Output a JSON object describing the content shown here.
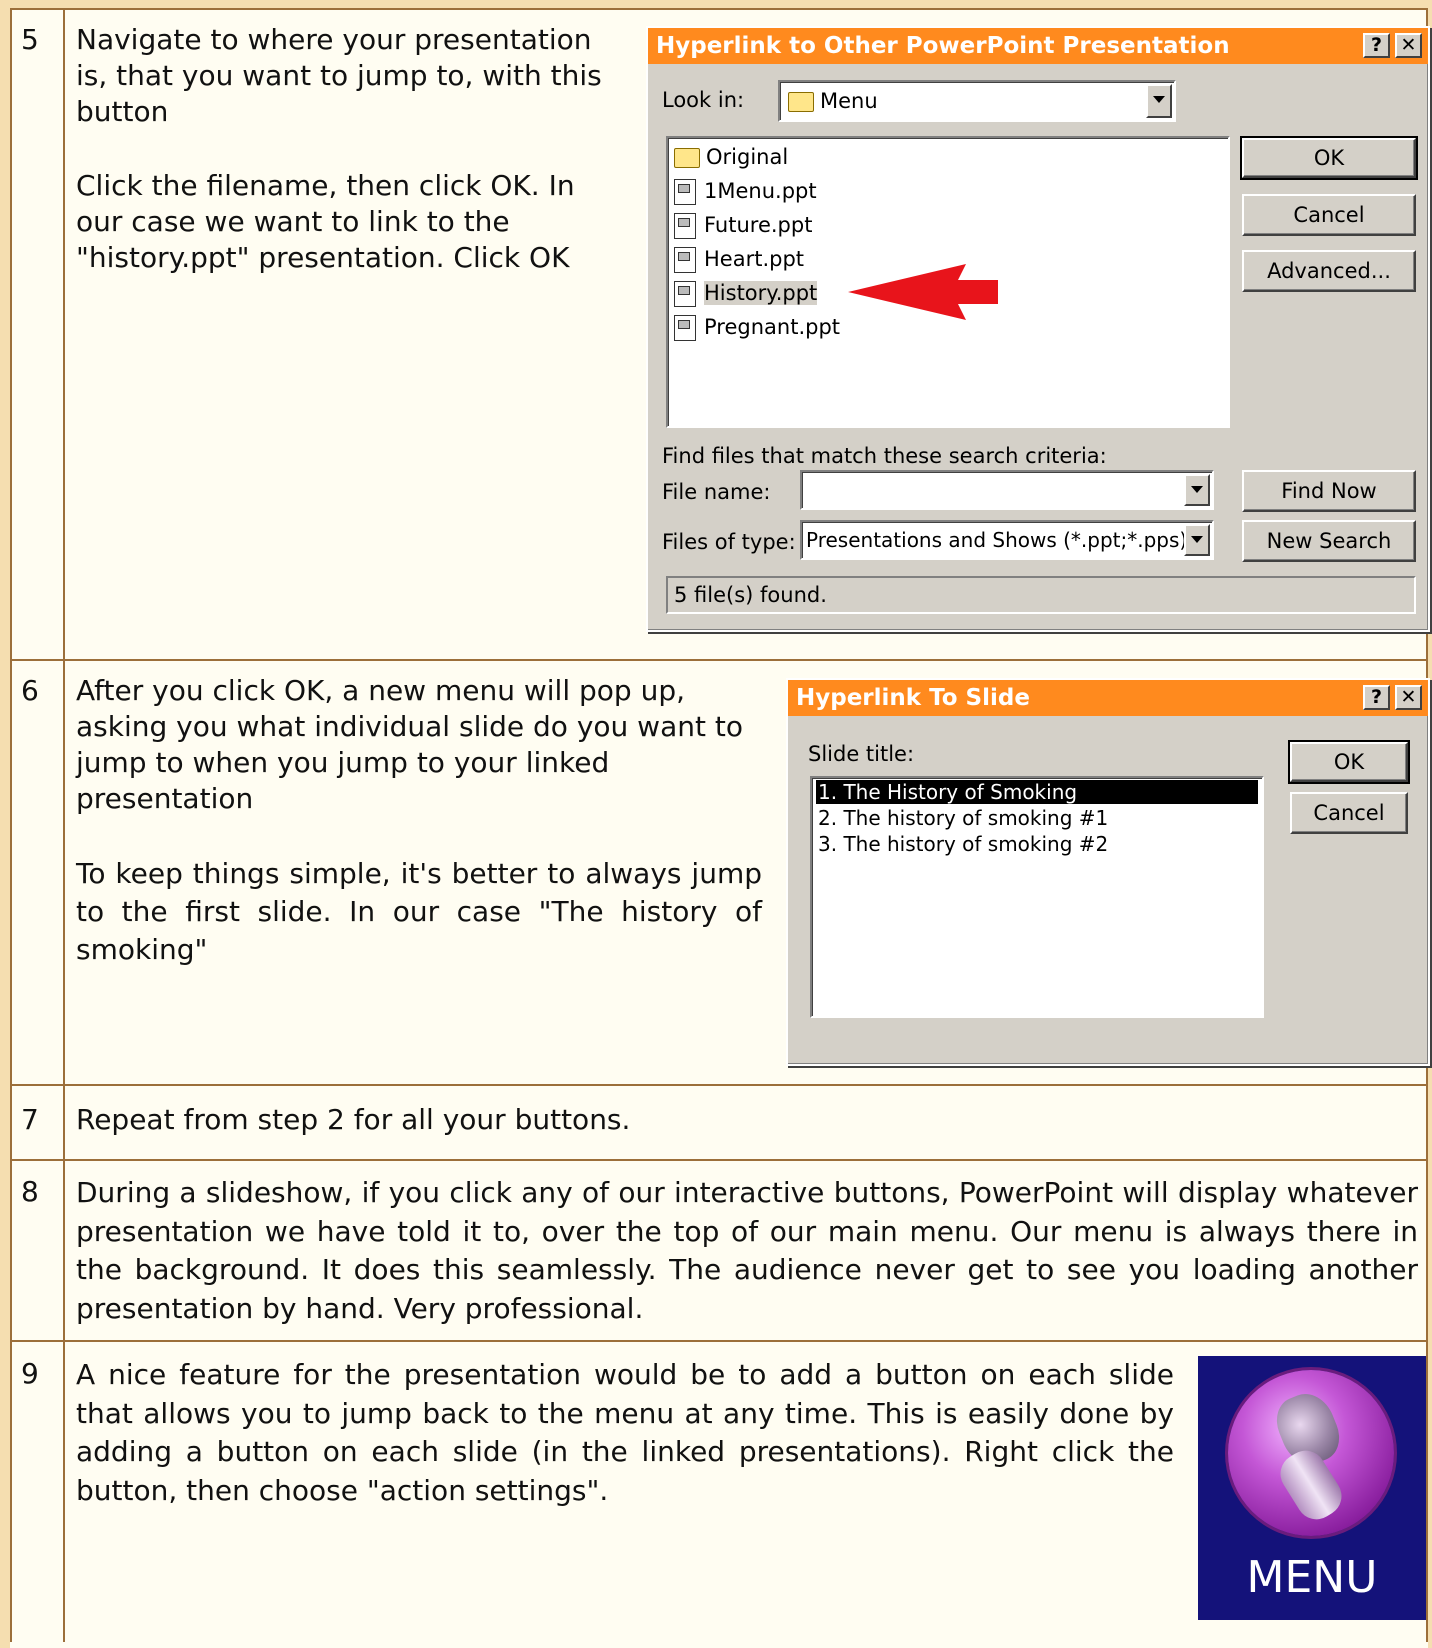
{
  "steps": [
    {
      "number": "5",
      "paragraphs": [
        "Navigate to where your presentation is, that you want to jump to, with this button",
        "Click the filename, then click OK. In our case we want to link to the \"history.ppt\" presentation. Click OK"
      ]
    },
    {
      "number": "6",
      "paragraphs": [
        "After you click OK, a new menu will pop up, asking you what individual slide do you want to jump to when you jump to your linked presentation",
        "To keep things simple, it's better to always jump to the first slide. In our case \"The history of smoking\""
      ]
    },
    {
      "number": "7",
      "paragraphs": [
        "Repeat from step 2 for all your buttons."
      ]
    },
    {
      "number": "8",
      "paragraphs": [
        "During a slideshow, if you click any of our interactive buttons, PowerPoint will display whatever presentation we have told it to, over the top of our main menu. Our menu is always there in the background. It does this seamlessly. The audience never get to see you loading another presentation by hand. Very professional."
      ]
    },
    {
      "number": "9",
      "paragraphs": [
        "A nice feature for the presentation would be to add a button on each slide that allows you to jump back to the menu at any time. This is easily done by adding a button on each slide (in the linked presentations). Right click the button, then choose \"action settings\"."
      ]
    }
  ],
  "dialog_presentation": {
    "title": "Hyperlink to Other PowerPoint Presentation",
    "help_button": "?",
    "close_button": "✕",
    "look_in_label": "Look in:",
    "look_in_value": "Menu",
    "files": [
      {
        "name": "Original",
        "icon": "folder-icon",
        "selected": false
      },
      {
        "name": "1Menu.ppt",
        "icon": "ppt-file-icon",
        "selected": false
      },
      {
        "name": "Future.ppt",
        "icon": "ppt-file-icon",
        "selected": false
      },
      {
        "name": "Heart.ppt",
        "icon": "ppt-file-icon",
        "selected": false
      },
      {
        "name": "History.ppt",
        "icon": "ppt-file-icon",
        "selected": true
      },
      {
        "name": "Pregnant.ppt",
        "icon": "ppt-file-icon",
        "selected": false
      }
    ],
    "ok_label": "OK",
    "cancel_label": "Cancel",
    "advanced_label": "Advanced...",
    "search_criteria_label": "Find files that match these search criteria:",
    "file_name_label": "File name:",
    "file_name_value": "",
    "files_of_type_label": "Files of type:",
    "files_of_type_value": "Presentations and Shows (*.ppt;*.pps)",
    "find_now_label": "Find Now",
    "new_search_label": "New Search",
    "status_text": "5 file(s) found.",
    "arrow_color": "#e8141b"
  },
  "dialog_slide": {
    "title": "Hyperlink To Slide",
    "help_button": "?",
    "close_button": "✕",
    "slide_title_label": "Slide title:",
    "slides": [
      {
        "text": "1. The History of Smoking",
        "selected": true
      },
      {
        "text": "2. The history of smoking #1",
        "selected": false
      },
      {
        "text": "3. The history of smoking #2",
        "selected": false
      }
    ],
    "ok_label": "OK",
    "cancel_label": "Cancel"
  },
  "menu_button_image": {
    "label": "MENU",
    "background_color": "#14127a",
    "orb_color": "#b33fc2"
  },
  "colors": {
    "border": "#9c6f3a",
    "margin": "#f5deb0",
    "titlebar": "#ff8a1e"
  }
}
